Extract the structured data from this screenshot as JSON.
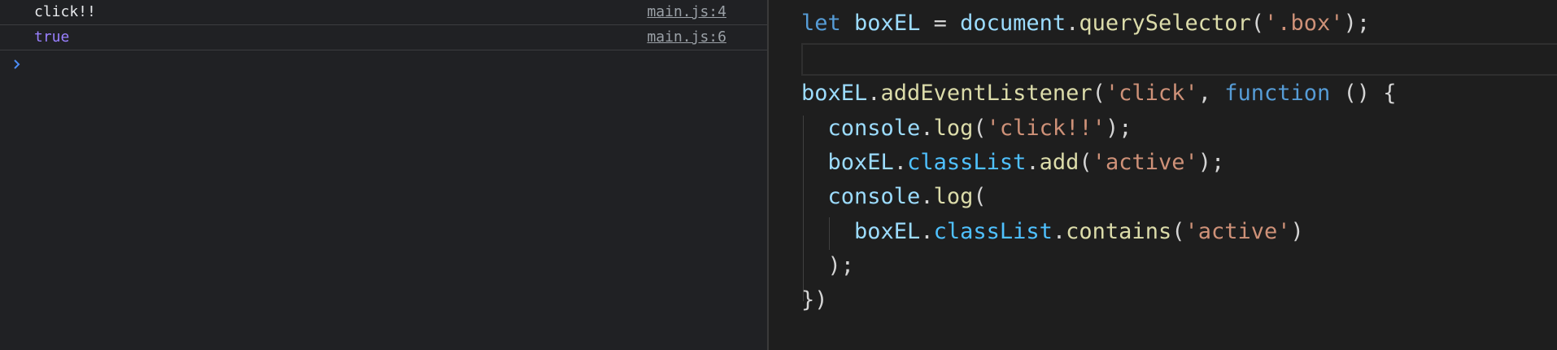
{
  "console": {
    "messages": [
      {
        "text": "click!!",
        "type": "string",
        "source": "main.js:4"
      },
      {
        "text": "true",
        "type": "boolean",
        "source": "main.js:6"
      }
    ],
    "prompt_placeholder": ""
  },
  "editor": {
    "lines": [
      [
        [
          "kw",
          "let"
        ],
        [
          "punc",
          " "
        ],
        [
          "var",
          "boxEL"
        ],
        [
          "punc",
          " = "
        ],
        [
          "var",
          "document"
        ],
        [
          "punc",
          "."
        ],
        [
          "fn",
          "querySelector"
        ],
        [
          "punc",
          "("
        ],
        [
          "str",
          "'.box'"
        ],
        [
          "punc",
          ");"
        ]
      ],
      [],
      [
        [
          "var",
          "boxEL"
        ],
        [
          "punc",
          "."
        ],
        [
          "fn",
          "addEventListener"
        ],
        [
          "punc",
          "("
        ],
        [
          "str",
          "'click'"
        ],
        [
          "punc",
          ", "
        ],
        [
          "kw",
          "function"
        ],
        [
          "punc",
          " () {"
        ]
      ],
      [
        [
          "punc",
          "  "
        ],
        [
          "var",
          "console"
        ],
        [
          "punc",
          "."
        ],
        [
          "fn",
          "log"
        ],
        [
          "punc",
          "("
        ],
        [
          "str",
          "'click!!'"
        ],
        [
          "punc",
          ");"
        ]
      ],
      [
        [
          "punc",
          "  "
        ],
        [
          "var",
          "boxEL"
        ],
        [
          "punc",
          "."
        ],
        [
          "prop",
          "classList"
        ],
        [
          "punc",
          "."
        ],
        [
          "fn",
          "add"
        ],
        [
          "punc",
          "("
        ],
        [
          "str",
          "'active'"
        ],
        [
          "punc",
          ");"
        ]
      ],
      [
        [
          "punc",
          "  "
        ],
        [
          "var",
          "console"
        ],
        [
          "punc",
          "."
        ],
        [
          "fn",
          "log"
        ],
        [
          "punc",
          "("
        ]
      ],
      [
        [
          "punc",
          "    "
        ],
        [
          "var",
          "boxEL"
        ],
        [
          "punc",
          "."
        ],
        [
          "prop",
          "classList"
        ],
        [
          "punc",
          "."
        ],
        [
          "fn",
          "contains"
        ],
        [
          "punc",
          "("
        ],
        [
          "str",
          "'active'"
        ],
        [
          "punc",
          ")"
        ]
      ],
      [
        [
          "punc",
          "  );"
        ]
      ],
      [
        [
          "punc",
          "})"
        ]
      ]
    ]
  },
  "colors": {
    "console_bg": "#202124",
    "editor_bg": "#1e1e1e",
    "boolean": "#9980ff",
    "prompt_chevron": "#4c8df6",
    "keyword": "#569cd6",
    "variable": "#9cdcfe",
    "function": "#dcdcaa",
    "string": "#ce9178",
    "property": "#4fc1ff"
  }
}
